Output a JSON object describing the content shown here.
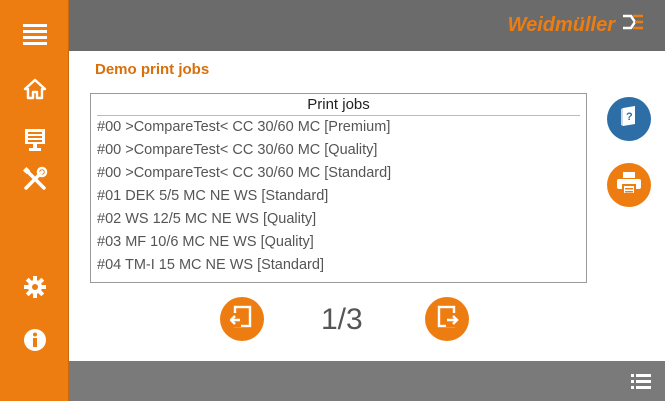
{
  "brand": {
    "name": "Weidmüller"
  },
  "sidebar": {
    "items": [
      {
        "icon": "menu-icon"
      },
      {
        "icon": "home-icon"
      },
      {
        "icon": "monitor-icon"
      },
      {
        "icon": "tools-icon"
      },
      {
        "icon": "settings-gear-icon"
      },
      {
        "icon": "info-icon"
      }
    ]
  },
  "page": {
    "title": "Demo print jobs"
  },
  "joblist": {
    "header": "Print jobs",
    "items": [
      "#00 >CompareTest< CC 30/60 MC [Premium]",
      "#00 >CompareTest< CC 30/60 MC [Quality]",
      "#00 >CompareTest< CC 30/60 MC [Standard]",
      "#01 DEK 5/5 MC NE WS [Standard]",
      "#02 WS 12/5 MC NE WS [Quality]",
      "#03 MF 10/6 MC NE WS [Quality]",
      "#04 TM-I 15 MC NE WS [Standard]"
    ]
  },
  "pager": {
    "text": "1/3"
  },
  "colors": {
    "accent": "#ee7d11",
    "blue": "#2e6ea6",
    "header": "#6b6b6b",
    "footer": "#7a7a7a"
  }
}
